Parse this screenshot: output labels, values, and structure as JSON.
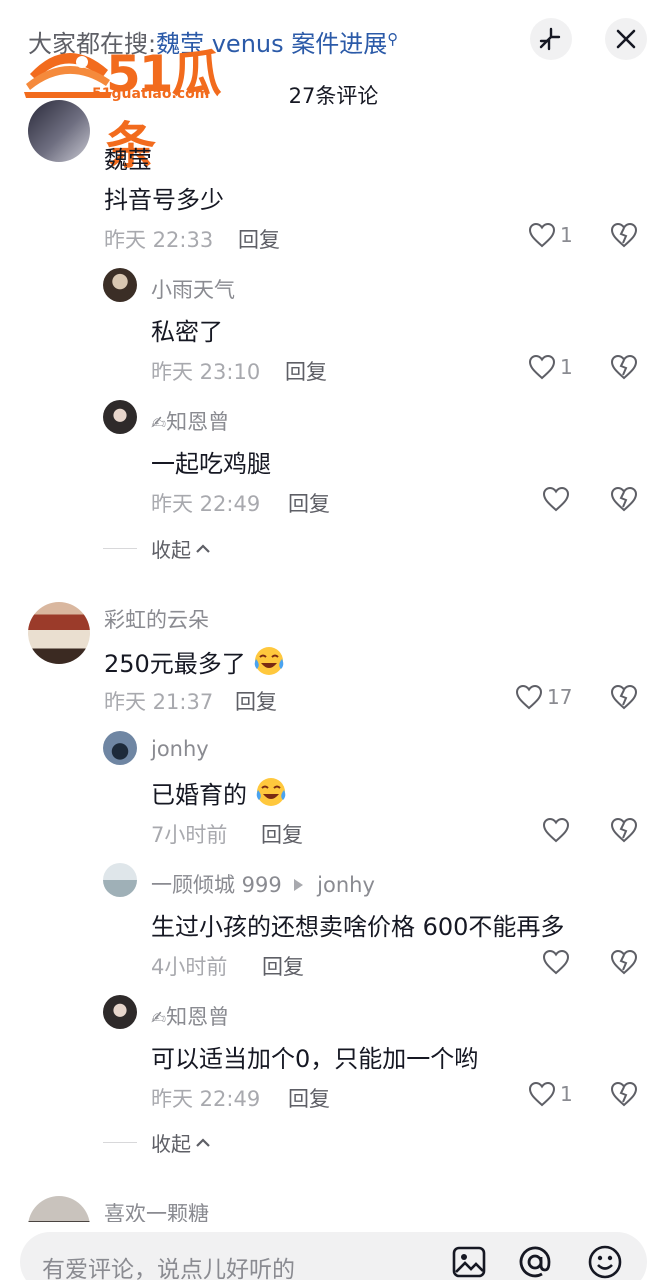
{
  "header": {
    "search_prefix": "大家都在搜:",
    "search_keyword": "魏莹 venus 案件进展",
    "comment_count": "27条评论",
    "logo_text": "51瓜条",
    "logo_domain": "51guatiao.com"
  },
  "comments": [
    {
      "name": "魏莹",
      "text": "抖音号多少",
      "time": "昨天 22:33",
      "reply": "回复",
      "likes": "1",
      "replies": [
        {
          "name": "小雨天气",
          "text": "私密了",
          "time": "昨天 23:10",
          "reply": "回复",
          "likes": "1"
        },
        {
          "name": "知恩曾",
          "text": "一起吃鸡腿",
          "time": "昨天 22:49",
          "reply": "回复",
          "likes": ""
        }
      ],
      "collapse": "收起"
    },
    {
      "name": "彩虹的云朵",
      "text": "250元最多了",
      "time": "昨天 21:37",
      "reply": "回复",
      "likes": "17",
      "replies": [
        {
          "name": "jonhy",
          "text": "已婚育的",
          "time": "7小时前",
          "reply": "回复",
          "likes": ""
        },
        {
          "name": "一顾倾城 999",
          "reply_to": "jonhy",
          "text": "生过小孩的还想卖啥价格 600不能再多",
          "time": "4小时前",
          "reply": "回复",
          "likes": ""
        },
        {
          "name": "知恩曾",
          "text": "可以适当加个0，只能加一个哟",
          "time": "昨天 22:49",
          "reply": "回复",
          "likes": "1"
        }
      ],
      "collapse": "收起"
    },
    {
      "name": "喜欢一颗糖"
    }
  ],
  "input": {
    "placeholder": "有爱评论，说点儿好听的"
  }
}
